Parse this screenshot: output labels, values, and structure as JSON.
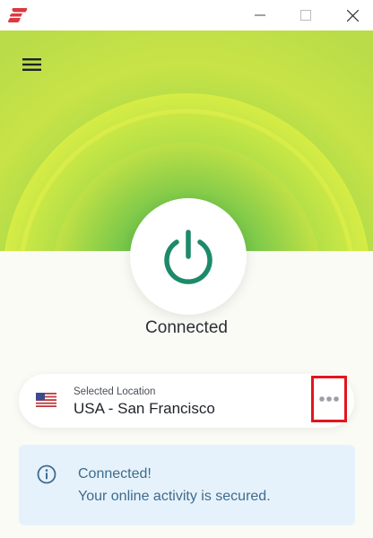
{
  "window": {
    "logo_icon": "expressvpn-logo-icon",
    "controls": [
      "minimize-icon",
      "maximize-icon",
      "close-icon"
    ]
  },
  "header": {
    "menu_icon": "hamburger-menu-icon"
  },
  "power": {
    "icon": "power-icon",
    "color": "#1c8a6a"
  },
  "status": {
    "text": "Connected"
  },
  "location": {
    "label": "Selected Location",
    "value": "USA - San Francisco",
    "flag_icon": "us-flag-icon",
    "more_icon": "more-options-icon",
    "highlight_color": "#e3151c"
  },
  "notice": {
    "icon": "info-icon",
    "title": "Connected!",
    "message": "Your online activity is secured."
  },
  "colors": {
    "hero_outer": "#c9e24a",
    "hero_inner": "#7ecf4a",
    "background": "#fbfbf6",
    "notice_bg": "#e6f2fb",
    "notice_text": "#3f6b8d"
  }
}
